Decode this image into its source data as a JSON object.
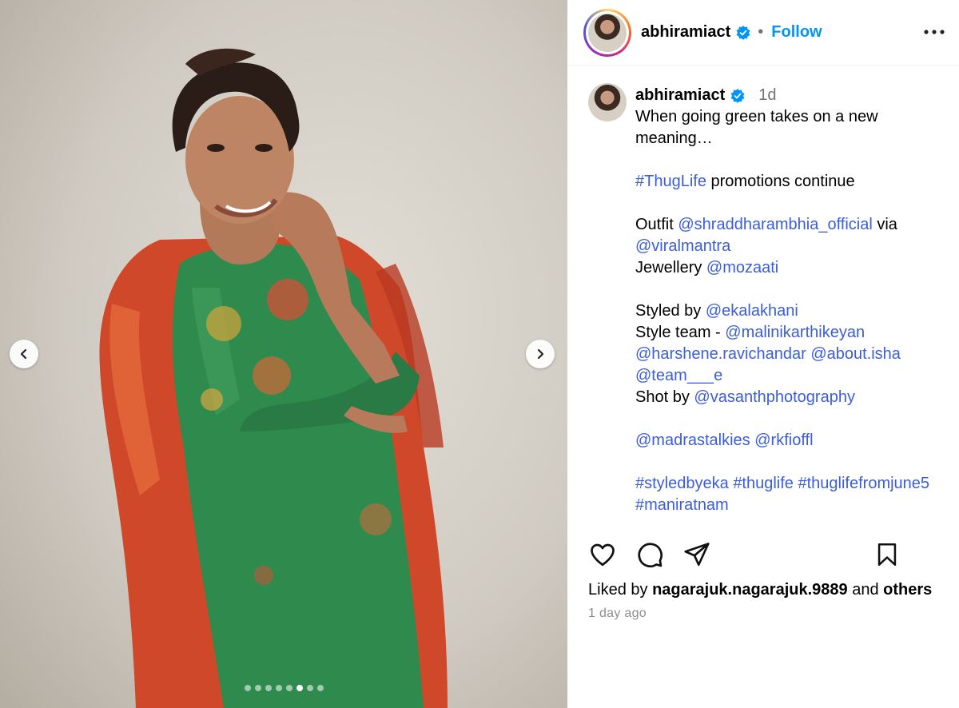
{
  "post": {
    "username": "abhiramiact",
    "follow_label": "Follow",
    "separator": "•",
    "more_label": "More options",
    "carousel": {
      "total": 8,
      "active_index": 5
    },
    "caption": {
      "time": "1d",
      "lines": [
        [
          {
            "t": "When going green takes on a new meaning…"
          }
        ],
        [],
        [
          {
            "t": "#ThugLife",
            "link": true
          },
          {
            "t": " promotions continue"
          }
        ],
        [],
        [
          {
            "t": "Outfit "
          },
          {
            "t": "@shraddharambhia_official",
            "link": true
          },
          {
            "t": " via "
          },
          {
            "t": "@viralmantra",
            "link": true
          }
        ],
        [
          {
            "t": "Jewellery "
          },
          {
            "t": "@mozaati",
            "link": true
          }
        ],
        [],
        [
          {
            "t": "Styled by "
          },
          {
            "t": "@ekalakhani",
            "link": true
          }
        ],
        [
          {
            "t": "Style team - "
          },
          {
            "t": "@malinikarthikeyan",
            "link": true
          },
          {
            "t": " "
          },
          {
            "t": "@harshene.ravichandar",
            "link": true
          },
          {
            "t": " "
          },
          {
            "t": "@about.isha",
            "link": true
          },
          {
            "t": " "
          },
          {
            "t": "@team___e",
            "link": true
          }
        ],
        [
          {
            "t": "Shot by "
          },
          {
            "t": "@vasanthphotography",
            "link": true
          }
        ],
        [],
        [
          {
            "t": "@madrastalkies",
            "link": true
          },
          {
            "t": " "
          },
          {
            "t": "@rkfioffl",
            "link": true
          }
        ],
        [],
        [
          {
            "t": "#styledbyeka",
            "link": true
          },
          {
            "t": " "
          },
          {
            "t": "#thuglife",
            "link": true
          },
          {
            "t": " "
          },
          {
            "t": "#thuglifefromjune5",
            "link": true
          },
          {
            "t": " "
          },
          {
            "t": "#maniratnam",
            "link": true
          }
        ]
      ]
    },
    "likes": {
      "prefix": "Liked by ",
      "user": "nagarajuk.nagarajuk.9889",
      "middle": " and ",
      "others": "others"
    },
    "posted_ago": "1 day ago"
  },
  "colors": {
    "link": "#3b5ed8",
    "follow": "#0095f6",
    "verified": "#0095f6",
    "muted": "#737373"
  },
  "icons": {
    "like": "heart-icon",
    "comment": "comment-bubble-icon",
    "share": "paper-plane-icon",
    "save": "bookmark-icon",
    "prev": "chevron-left-icon",
    "next": "chevron-right-icon"
  }
}
